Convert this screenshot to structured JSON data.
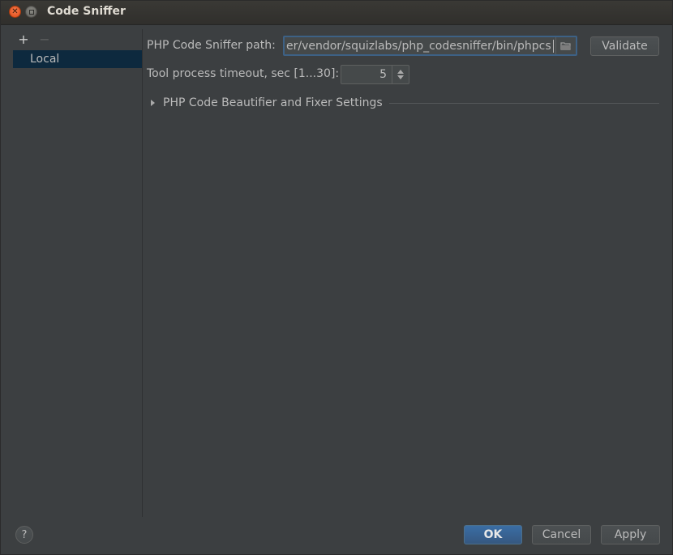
{
  "window": {
    "title": "Code Sniffer"
  },
  "left_panel": {
    "add_label": "+",
    "remove_label": "−",
    "items": [
      {
        "label": "Local",
        "selected": true
      }
    ]
  },
  "settings": {
    "path_label": "PHP Code Sniffer path:",
    "path_value": "er/vendor/squizlabs/php_codesniffer/bin/phpcs",
    "validate_label": "Validate",
    "timeout_label": "Tool process timeout, sec [1...30]:",
    "timeout_value": "5",
    "section_title": "PHP Code Beautifier and Fixer Settings"
  },
  "footer": {
    "help_label": "?",
    "ok_label": "OK",
    "cancel_label": "Cancel",
    "apply_label": "Apply"
  },
  "colors": {
    "background": "#3c3f41",
    "selection": "#0d293e",
    "focus_border": "#3d6185",
    "primary_button": "#365880"
  }
}
